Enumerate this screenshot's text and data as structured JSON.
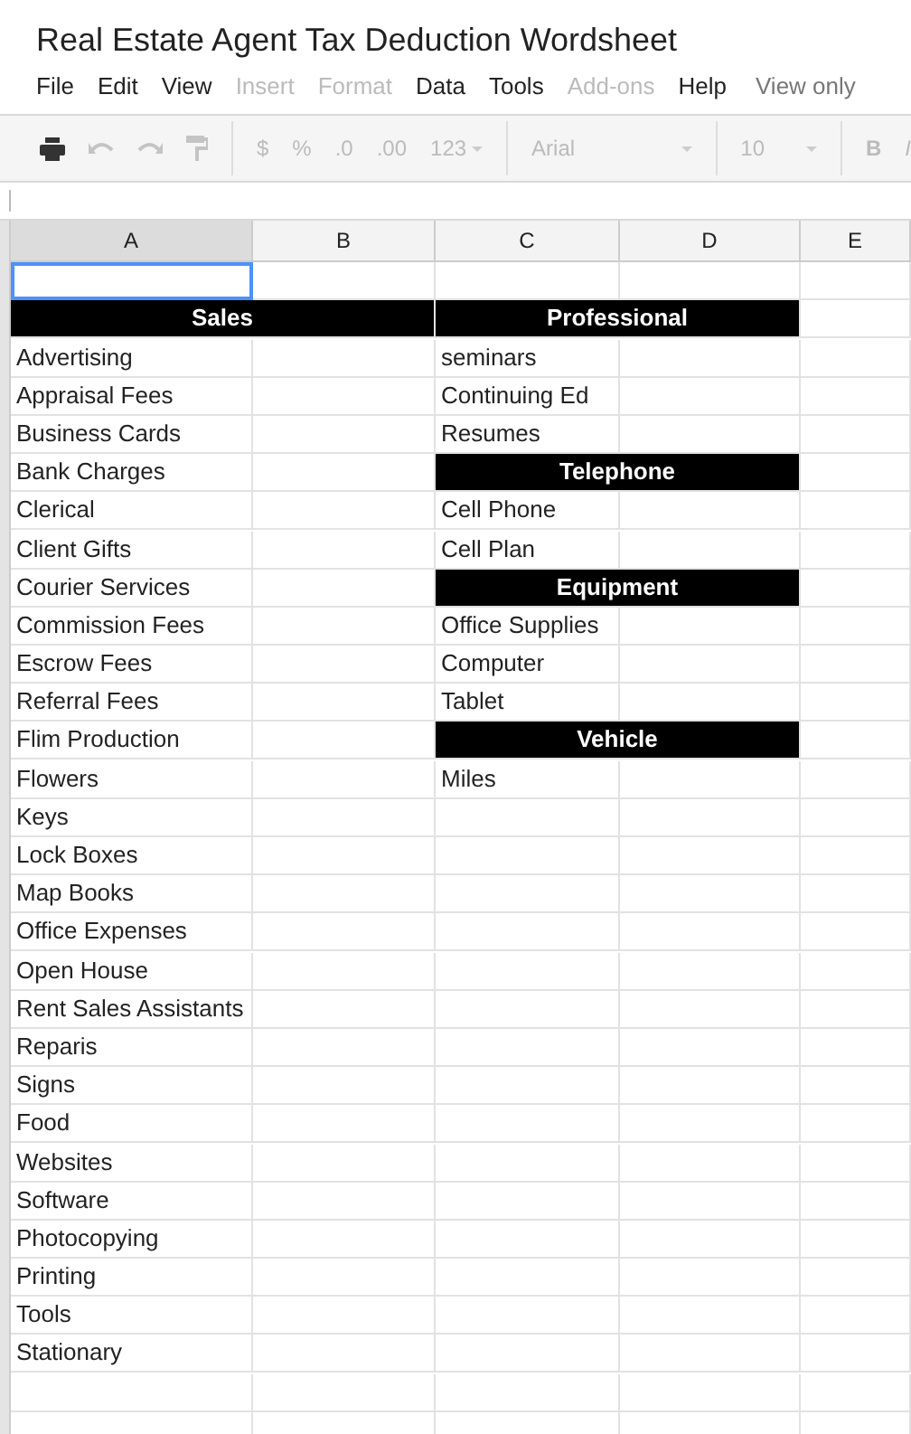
{
  "document": {
    "title": "Real Estate Agent Tax Deduction Wordsheet"
  },
  "menu": [
    {
      "label": "File",
      "disabled": false
    },
    {
      "label": "Edit",
      "disabled": false
    },
    {
      "label": "View",
      "disabled": false
    },
    {
      "label": "Insert",
      "disabled": true
    },
    {
      "label": "Format",
      "disabled": true
    },
    {
      "label": "Data",
      "disabled": false
    },
    {
      "label": "Tools",
      "disabled": false
    },
    {
      "label": "Add-ons",
      "disabled": true
    },
    {
      "label": "Help",
      "disabled": false
    }
  ],
  "mode_label": "View only",
  "toolbar": [
    {
      "kind": "print",
      "disabled": false
    },
    {
      "kind": "undo",
      "disabled": true
    },
    {
      "kind": "redo",
      "disabled": true
    },
    {
      "kind": "paint",
      "disabled": true
    },
    {
      "kind": "separator"
    },
    {
      "kind": "text",
      "label": "$",
      "disabled": true
    },
    {
      "kind": "text",
      "label": "%",
      "disabled": true
    },
    {
      "kind": "decimal",
      "label": ".0",
      "disabled": true
    },
    {
      "kind": "decimal",
      "label": ".00",
      "disabled": true
    },
    {
      "kind": "dropdown",
      "label": "123",
      "disabled": true
    },
    {
      "kind": "separator"
    },
    {
      "kind": "select",
      "label": "Arial",
      "disabled": true
    },
    {
      "kind": "separator"
    },
    {
      "kind": "select",
      "label": "10",
      "disabled": true
    },
    {
      "kind": "separator"
    },
    {
      "kind": "bold",
      "label": "B",
      "disabled": true
    },
    {
      "kind": "italic",
      "label": "I",
      "disabled": true
    }
  ],
  "columns": [
    {
      "label": "A",
      "selected": true
    },
    {
      "label": "B",
      "selected": false
    },
    {
      "label": "C",
      "selected": false
    },
    {
      "label": "D",
      "selected": false
    },
    {
      "label": "E",
      "selected": false
    }
  ],
  "rows": [
    {
      "a": {
        "kind": "active"
      }
    },
    {
      "a": {
        "kind": "header",
        "text": "Sales"
      },
      "c": {
        "kind": "header",
        "text": "Professional"
      }
    },
    {
      "a": {
        "kind": "text",
        "text": "Advertising"
      },
      "c": {
        "kind": "text",
        "text": "seminars"
      }
    },
    {
      "a": {
        "kind": "text",
        "text": "Appraisal Fees"
      },
      "c": {
        "kind": "text",
        "text": "Continuing Ed"
      }
    },
    {
      "a": {
        "kind": "text",
        "text": "Business Cards"
      },
      "c": {
        "kind": "text",
        "text": "Resumes"
      }
    },
    {
      "a": {
        "kind": "text",
        "text": "Bank Charges"
      },
      "c": {
        "kind": "header",
        "text": "Telephone"
      }
    },
    {
      "a": {
        "kind": "text",
        "text": "Clerical"
      },
      "c": {
        "kind": "text",
        "text": "Cell Phone"
      }
    },
    {
      "a": {
        "kind": "text",
        "text": "Client Gifts"
      },
      "c": {
        "kind": "text",
        "text": "Cell Plan"
      }
    },
    {
      "a": {
        "kind": "text",
        "text": "Courier Services"
      },
      "c": {
        "kind": "header",
        "text": "Equipment"
      }
    },
    {
      "a": {
        "kind": "text",
        "text": "Commission Fees"
      },
      "c": {
        "kind": "text",
        "text": "Office Supplies"
      }
    },
    {
      "a": {
        "kind": "text",
        "text": "Escrow Fees"
      },
      "c": {
        "kind": "text",
        "text": "Computer"
      }
    },
    {
      "a": {
        "kind": "text",
        "text": "Referral Fees"
      },
      "c": {
        "kind": "text",
        "text": "Tablet"
      }
    },
    {
      "a": {
        "kind": "text",
        "text": "Flim Production"
      },
      "c": {
        "kind": "header",
        "text": "Vehicle"
      }
    },
    {
      "a": {
        "kind": "text",
        "text": "Flowers"
      },
      "c": {
        "kind": "text",
        "text": "Miles"
      }
    },
    {
      "a": {
        "kind": "text",
        "text": "Keys"
      }
    },
    {
      "a": {
        "kind": "text",
        "text": "Lock Boxes"
      }
    },
    {
      "a": {
        "kind": "text",
        "text": "Map Books"
      }
    },
    {
      "a": {
        "kind": "text",
        "text": "Office Expenses"
      }
    },
    {
      "a": {
        "kind": "text",
        "text": "Open House"
      }
    },
    {
      "a": {
        "kind": "text",
        "text": "Rent Sales Assistants"
      }
    },
    {
      "a": {
        "kind": "text",
        "text": "Reparis"
      }
    },
    {
      "a": {
        "kind": "text",
        "text": "Signs"
      }
    },
    {
      "a": {
        "kind": "text",
        "text": "Food"
      }
    },
    {
      "a": {
        "kind": "text",
        "text": "Websites"
      }
    },
    {
      "a": {
        "kind": "text",
        "text": "Software"
      }
    },
    {
      "a": {
        "kind": "text",
        "text": "Photocopying"
      }
    },
    {
      "a": {
        "kind": "text",
        "text": "Printing"
      }
    },
    {
      "a": {
        "kind": "text",
        "text": "Tools"
      }
    },
    {
      "a": {
        "kind": "text",
        "text": "Stationary"
      }
    },
    {},
    {}
  ]
}
